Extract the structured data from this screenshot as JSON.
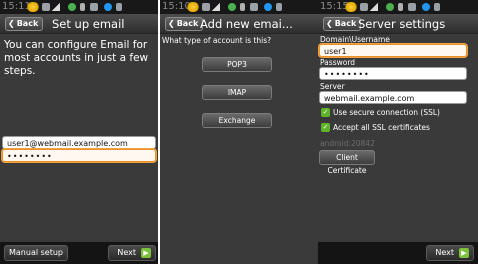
{
  "status": {
    "s1_time": "15:11",
    "s2_time": "15:10",
    "s3_time": "15:15"
  },
  "screen1": {
    "back": "Back",
    "title": "Set up email",
    "intro": "You can configure Email for most accounts in just a few steps.",
    "email_value": "user1@webmail.example.com",
    "password_value": "••••••••",
    "manual_setup": "Manual setup",
    "next": "Next"
  },
  "screen2": {
    "back": "Back",
    "title": "Add new emai...",
    "question": "What type of account is this?",
    "options": [
      "POP3",
      "IMAP",
      "Exchange"
    ]
  },
  "screen3": {
    "back": "Back",
    "title": "Server settings",
    "username_label": "Domain\\Username",
    "username_value": "user1",
    "password_label": "Password",
    "password_value": "••••••••",
    "server_label": "Server",
    "server_value": "webmail.example.com",
    "ssl_label": "Use secure connection (SSL)",
    "accept_label": "Accept all SSL certificates",
    "device_id": "android:20842",
    "client_cert": "Client Certificate",
    "next": "Next"
  },
  "colors": {
    "focus_outline": "#f2a340",
    "check_green": "#5fb52a",
    "next_green": "#7cc13a",
    "screen_bg": "#3a3a3a"
  }
}
